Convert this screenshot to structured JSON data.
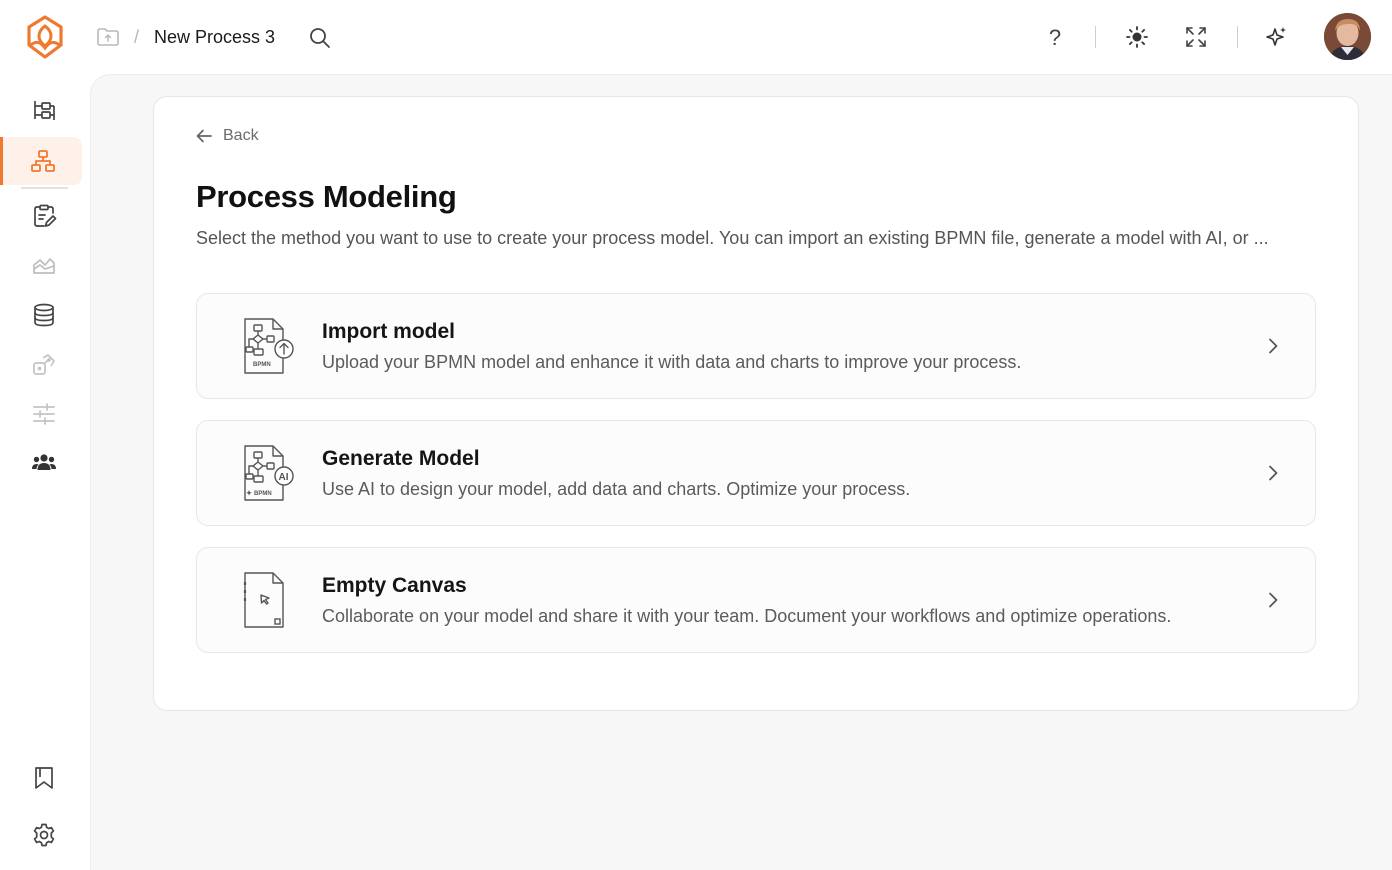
{
  "breadcrumb": {
    "separator": "/",
    "title": "New Process 3"
  },
  "topbar": {
    "help_label": "?"
  },
  "back": {
    "label": "Back"
  },
  "page": {
    "title": "Process Modeling",
    "description": "Select the method you want to use to create your process model. You can import an existing BPMN file, generate a model with AI, or ..."
  },
  "options": [
    {
      "title": "Import model",
      "description": "Upload your BPMN model and enhance it with data and charts to improve your process.",
      "icon_tag": "BPMN"
    },
    {
      "title": "Generate Model",
      "description": "Use AI to design your model, add data and charts. Optimize your process.",
      "icon_tag": "BPMN",
      "icon_badge": "AI"
    },
    {
      "title": "Empty Canvas",
      "description": "Collaborate on your model and share it with your team. Document your workflows and optimize operations."
    }
  ],
  "colors": {
    "accent": "#ef7a2f",
    "active_bg": "#fdf1ea"
  }
}
